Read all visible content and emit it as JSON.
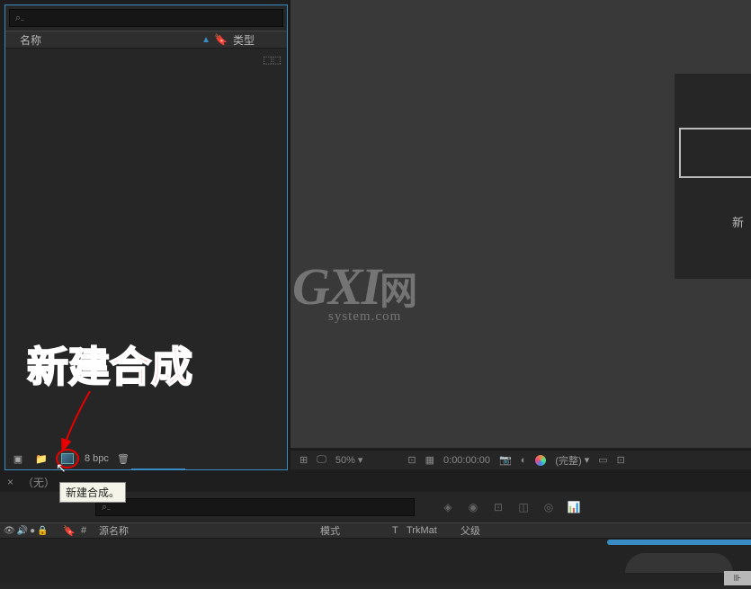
{
  "project": {
    "search_placeholder": "⌕₋",
    "header_name": "名称",
    "header_type": "类型",
    "bpc": "8 bpc",
    "new_comp_tooltip": "新建合成。"
  },
  "annotation": {
    "title": "新建合成"
  },
  "viewer": {
    "zoom": "50%",
    "timecode": "0:00:00:00",
    "res_label": "(完整)",
    "right_text": "新"
  },
  "watermark": {
    "main": "GXI",
    "wang": "网",
    "sub": "system.com"
  },
  "timeline": {
    "tab_none": "（无）",
    "search_placeholder": "⌕₋",
    "toggle_eye": "👁",
    "toggle_speaker": "🔊",
    "toggle_solo": "●",
    "toggle_lock": "🔒",
    "tag_icon": "🔖",
    "idx_label": "#",
    "src_label": "源名称",
    "mode_label": "模式",
    "t_label": "T",
    "trk_label": "TrkMat",
    "parent_label": "父级"
  }
}
